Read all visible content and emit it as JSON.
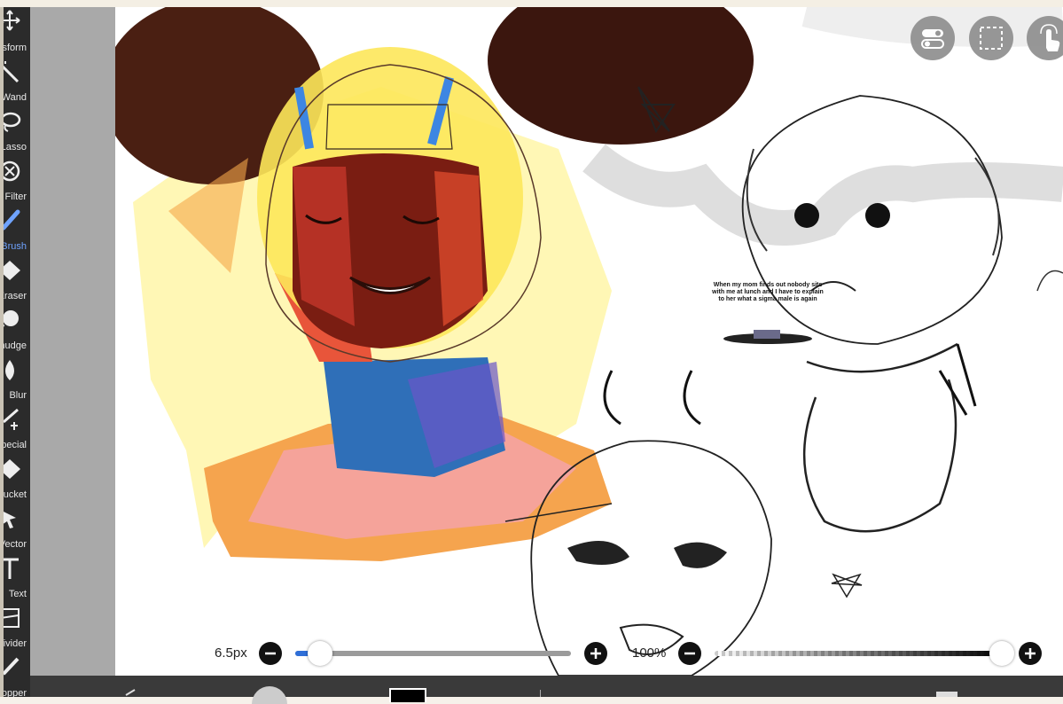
{
  "toolbar": {
    "tools": [
      {
        "label": "Transform",
        "icon": "transform-icon"
      },
      {
        "label": "Magic Wand",
        "icon": "magic-wand-icon"
      },
      {
        "label": "Lasso",
        "icon": "lasso-icon"
      },
      {
        "label": "Filter",
        "icon": "filter-icon"
      },
      {
        "label": "Brush",
        "icon": "brush-icon",
        "active": true
      },
      {
        "label": "Eraser",
        "icon": "eraser-icon"
      },
      {
        "label": "Smudge",
        "icon": "smudge-icon"
      },
      {
        "label": "Blur",
        "icon": "blur-icon"
      },
      {
        "label": "Special",
        "icon": "special-icon"
      },
      {
        "label": "Bucket",
        "icon": "bucket-icon"
      },
      {
        "label": "Vector",
        "icon": "vector-icon"
      },
      {
        "label": "Text",
        "icon": "text-icon"
      },
      {
        "label": "Frame Divider",
        "icon": "frame-divider-icon"
      },
      {
        "label": "Eyedropper",
        "icon": "eyedropper-icon"
      }
    ],
    "active_color": "#6fa3ff"
  },
  "canvas": {
    "meme_text": "When my mom finds out nobody sits with me at lunch and I have to explain to her what a sigma male is again"
  },
  "float_buttons": {
    "toggle_icon": "toggle-icon",
    "selection_icon": "selection-icon",
    "touch_icon": "touch-gesture-icon"
  },
  "brush": {
    "size_label": "6.5px",
    "size_fraction": 0.09,
    "opacity_label": "100%",
    "opacity_fraction": 1.0
  },
  "colors": {
    "accent": "#2f6fd8",
    "toolbar_bg": "#2b2b2b"
  }
}
